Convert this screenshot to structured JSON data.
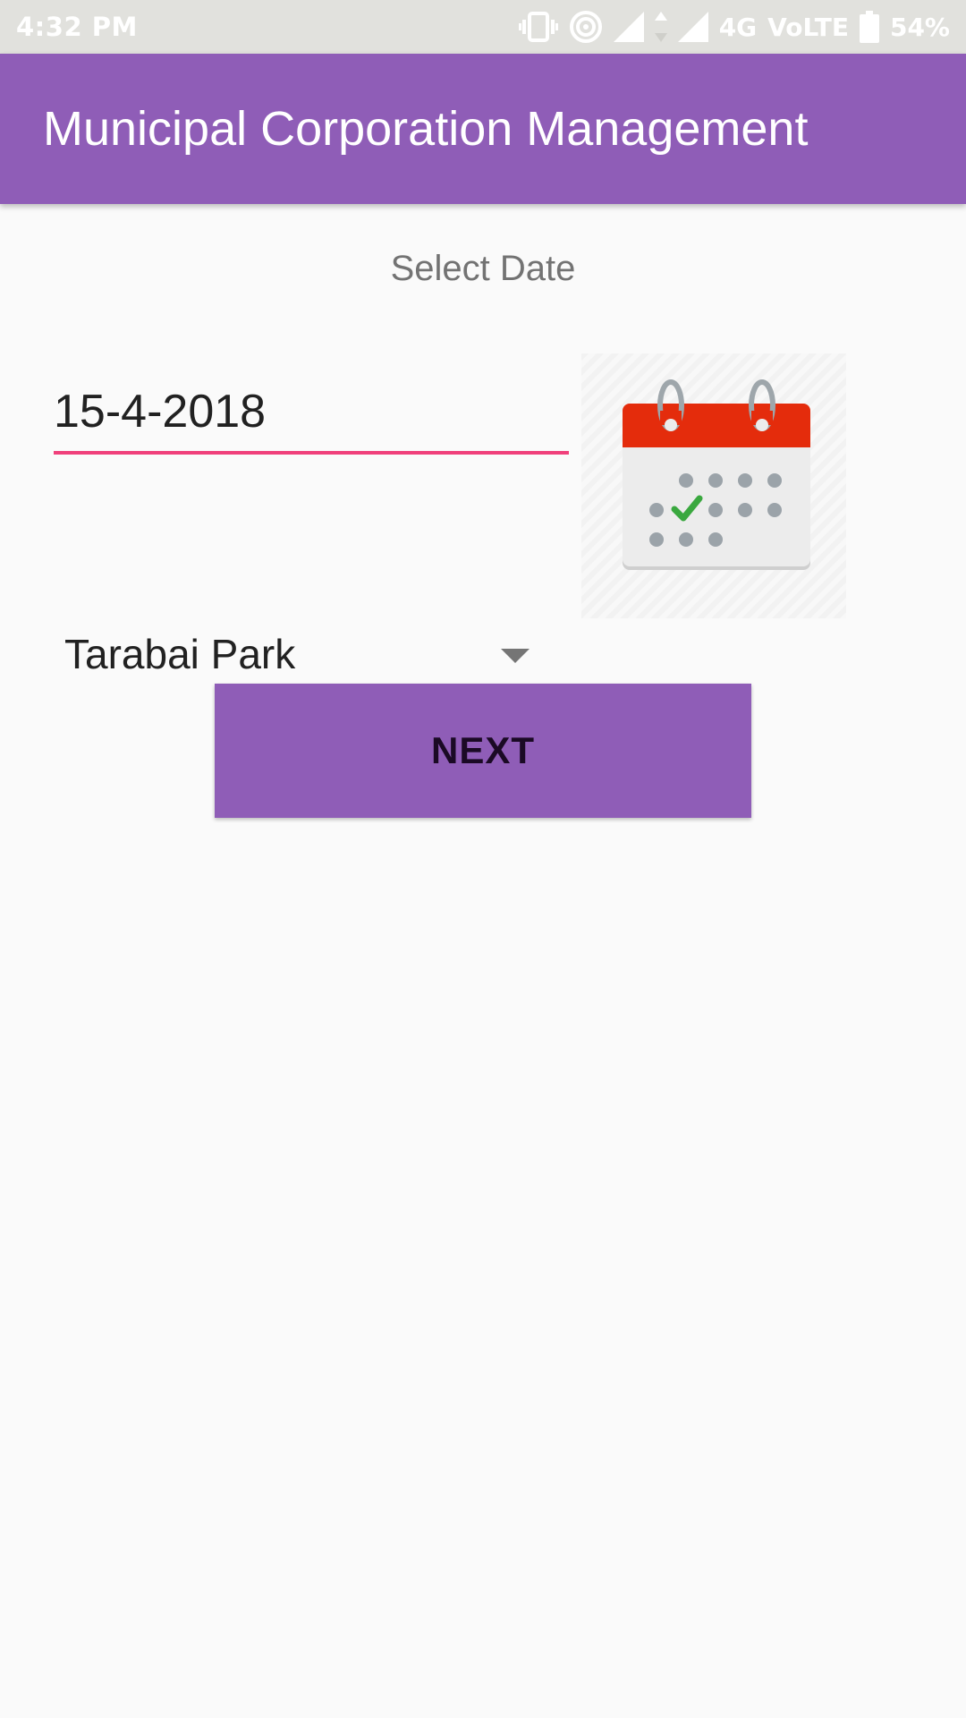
{
  "status_bar": {
    "time": "4:32 PM",
    "network_type": "4G",
    "volte_label": "VoLTE",
    "battery_percent": "54%",
    "icons": [
      "vibrate-icon",
      "hotspot-icon",
      "signal-icon",
      "data-arrows-icon",
      "signal-icon",
      "battery-icon"
    ]
  },
  "app_bar": {
    "title": "Municipal Corporation Management",
    "color": "#8f5db7"
  },
  "form": {
    "heading": "Select Date",
    "date_value": "15-4-2018",
    "date_underline_color": "#f0407b",
    "calendar_icon": "calendar-icon",
    "spinner_selected": "Tarabai Park",
    "spinner_icon": "dropdown-arrow-icon",
    "next_label": "NEXT"
  }
}
